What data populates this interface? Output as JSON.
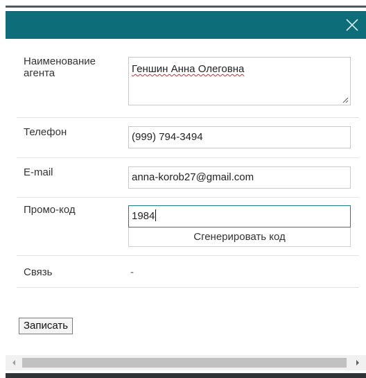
{
  "dialog": {
    "close_icon": "close-icon",
    "header_color": "#0d6e7a"
  },
  "form": {
    "agent_name_label": "Наименование агента",
    "agent_name_value": "Геншин Анна Олеговна",
    "phone_label": "Телефон",
    "phone_value": "(999) 794-3494",
    "email_label": "E-mail",
    "email_value": "anna-korob27@gmail.com",
    "promo_label": "Промо-код",
    "promo_value": "1984",
    "generate_button_label": "Сгенерировать код",
    "link_label": "Связь",
    "link_value": "-"
  },
  "actions": {
    "save_label": "Записать"
  },
  "scrollbar": {
    "left_arrow_icon": "chevron-left-icon",
    "right_arrow_icon": "chevron-right-icon"
  }
}
